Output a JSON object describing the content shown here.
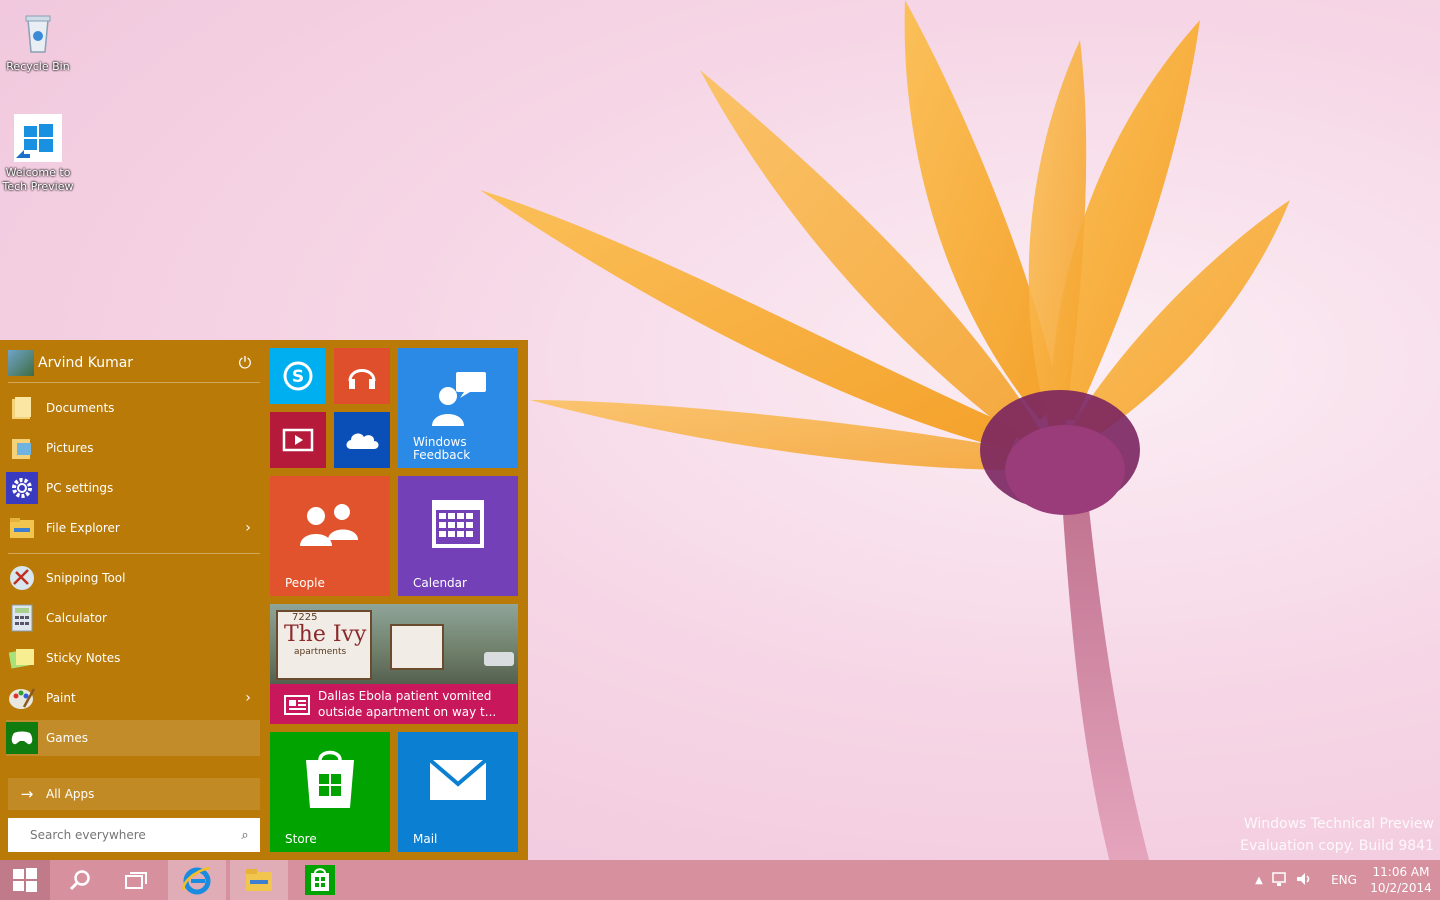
{
  "desktop": {
    "icons": [
      {
        "label": "Recycle Bin"
      },
      {
        "label_line1": "Welcome to",
        "label_line2": "Tech Preview"
      }
    ],
    "watermark_line1": "Windows Technical Preview",
    "watermark_line2": "Evaluation copy. Build 9841"
  },
  "start": {
    "user_name": "Arvind Kumar",
    "places": [
      {
        "label": "Documents"
      },
      {
        "label": "Pictures"
      },
      {
        "label": "PC settings"
      },
      {
        "label": "File Explorer"
      }
    ],
    "apps": [
      {
        "label": "Snipping Tool"
      },
      {
        "label": "Calculator"
      },
      {
        "label": "Sticky Notes"
      },
      {
        "label": "Paint"
      },
      {
        "label": "Games"
      }
    ],
    "all_apps_label": "All Apps",
    "search_placeholder": "Search everywhere"
  },
  "tiles": {
    "feedback_line1": "Windows",
    "feedback_line2": "Feedback",
    "people": "People",
    "calendar": "Calendar",
    "news_sign1": "7225",
    "news_sign2": "The Ivy",
    "news_sign3": "apartments",
    "news_line1": "Dallas Ebola patient vomited",
    "news_line2": "outside apartment on way t...",
    "store": "Store",
    "mail": "Mail"
  },
  "tray": {
    "lang": "ENG",
    "time": "11:06 AM",
    "date": "10/2/2014"
  },
  "colors": {
    "start_bg": "#b97a07",
    "skype": "#00aff0",
    "music": "#e04f2c",
    "video": "#b51a3a",
    "onedrive": "#0a4fb8",
    "feedback": "#2a8ae6",
    "people": "#e0532c",
    "calendar": "#7340b8",
    "news": "#c8175a",
    "store": "#00a300",
    "mail": "#0b7fd1",
    "taskbar": "#d6909e"
  }
}
